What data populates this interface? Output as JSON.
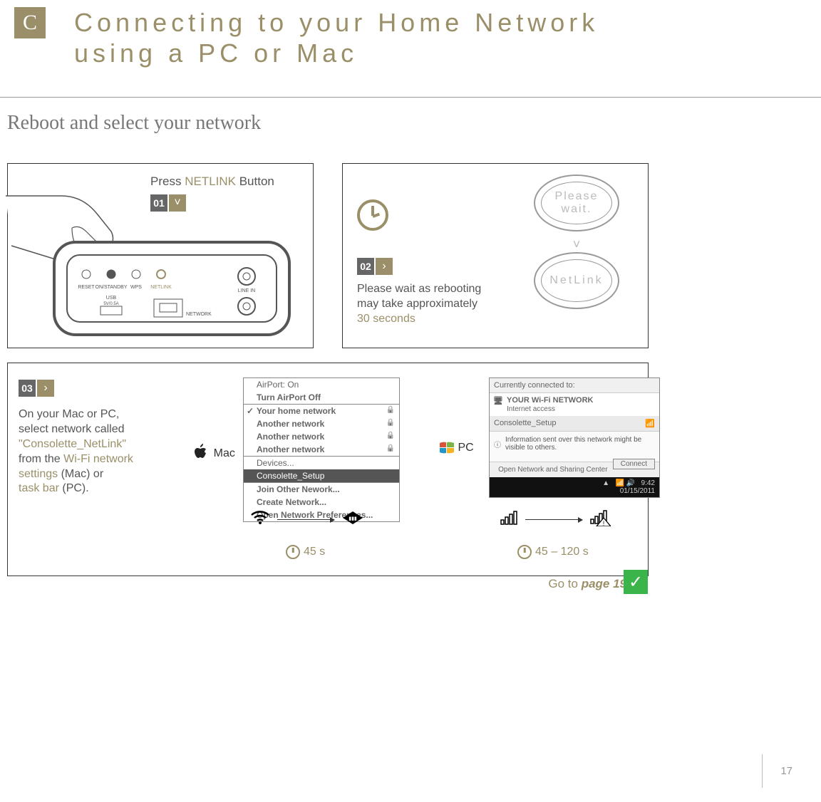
{
  "section": {
    "letter": "C",
    "title_line1": "Connecting to your Home Network",
    "title_line2": "using a PC or Mac"
  },
  "subhead": "Reboot and select your network",
  "step1": {
    "num": "01",
    "text_pre": "Press ",
    "text_hl": "NETLINK",
    "text_post": " Button",
    "buttons": [
      "RESET",
      "ON/STANDBY",
      "WPS",
      "NETLINK"
    ],
    "ports": [
      "USB",
      "5V/0.5A",
      "NETWORK",
      "LINE IN"
    ]
  },
  "step2": {
    "num": "02",
    "wait_line1": "Please wait as rebooting",
    "wait_line2": "may take approximately",
    "wait_hl": "30 seconds",
    "ring1": "Please wait.",
    "ring2": "NetLink"
  },
  "step3": {
    "num": "03",
    "text": {
      "l1": "On your Mac or PC,",
      "l2": "select network called",
      "hl1": "\"Consolette_NetLink\"",
      "l3": "from the ",
      "hl2": "Wi-Fi network",
      "hl3": "settings",
      "l4": " (Mac) or",
      "hl4": "task bar",
      "l5": " (PC)."
    },
    "mac_label": "Mac",
    "pc_label": "PC",
    "mac_menu": {
      "hdr1": "AirPort: On",
      "hdr2": "Turn AirPort Off",
      "items": [
        {
          "name": "Your home network",
          "check": true,
          "lock": true
        },
        {
          "name": "Another network",
          "lock": true
        },
        {
          "name": "Another network",
          "lock": true
        },
        {
          "name": "Another network",
          "lock": true
        }
      ],
      "devices": "Devices...",
      "sel": "Consolette_Setup",
      "foot": [
        "Join Other Nework...",
        "Create Network...",
        "Open Network Preferences..."
      ]
    },
    "pc_popup": {
      "hdr": "Currently connected to:",
      "net": "YOUR Wi-Fi NETWORK",
      "sub": "Internet access",
      "row2": "Consolette_Setup",
      "info": "Information sent over this network might be visible to others.",
      "connect": "Connect",
      "open": "Open Network and Sharing Center",
      "time": "9:42",
      "date": "01/15/2011"
    },
    "mac_time": "45 s",
    "pc_time": "45 – 120 s"
  },
  "footer": {
    "go_pre": "Go to ",
    "go_pg": "page 19",
    "page": "17"
  }
}
